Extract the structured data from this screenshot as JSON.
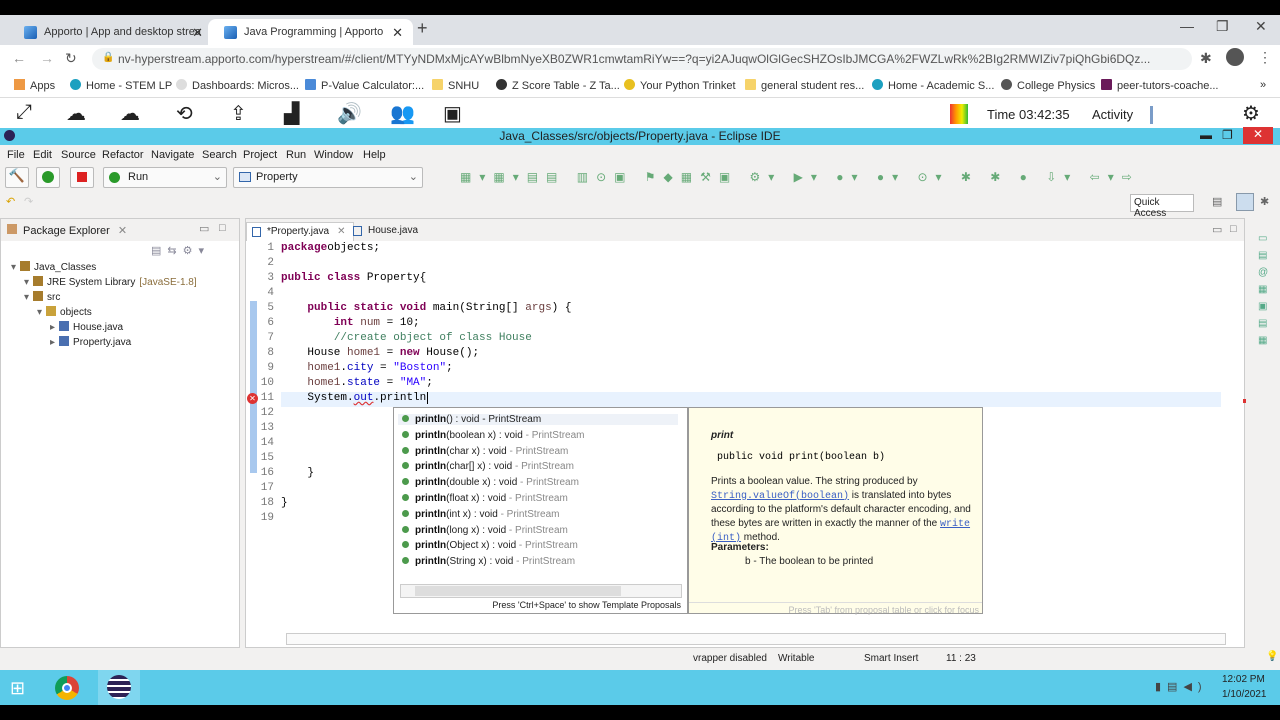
{
  "browser": {
    "tabs": [
      {
        "label": "Apporto | App and desktop strea"
      },
      {
        "label": "Java Programming | Apporto"
      }
    ],
    "url": "nv-hyperstream.apporto.com/hyperstream/#/client/MTYyNDMxMjcAYwBlbmNyeXB0ZWR1cmwtamRiYw==?q=yi2AJuqwOlGlGecSHZOsIbJMCGA%2FWZLwRk%2BIg2RMWIZiv7piQhGbi6DQz...",
    "bookmarks": [
      "Apps",
      "Home - STEM LP",
      "Dashboards: Micros...",
      "P-Value Calculator:...",
      "SNHU",
      "Z Score Table - Z Ta...",
      "Your Python Trinket",
      "general student res...",
      "Home - Academic S...",
      "College Physics",
      "peer-tutors-coache..."
    ]
  },
  "apporto": {
    "time": "Time 03:42:35",
    "activity": "Activity"
  },
  "eclipse": {
    "title": "Java_Classes/src/objects/Property.java - Eclipse IDE",
    "menu": [
      "File",
      "Edit",
      "Source",
      "Refactor",
      "Navigate",
      "Search",
      "Project",
      "Run",
      "Window",
      "Help"
    ],
    "run_combo": "Run",
    "launch_combo": "Property",
    "quick_access": "Quick Access",
    "package_explorer": {
      "title": "Package Explorer",
      "tree": [
        {
          "label": "Java_Classes",
          "level": 0
        },
        {
          "label": "JRE System Library",
          "suffix": "[JavaSE-1.8]",
          "level": 1
        },
        {
          "label": "src",
          "level": 1
        },
        {
          "label": "objects",
          "level": 2
        },
        {
          "label": "House.java",
          "level": 3
        },
        {
          "label": "Property.java",
          "level": 3
        }
      ]
    },
    "editor_tabs": [
      "*Property.java",
      "House.java"
    ],
    "code": [
      [
        [
          "kw",
          "package"
        ],
        [
          "",
          "objects;"
        ]
      ],
      [],
      [
        [
          "kw",
          "public class"
        ],
        [
          "",
          " Property{"
        ]
      ],
      [],
      [
        [
          "",
          "    "
        ],
        [
          "kw",
          "public static void"
        ],
        [
          "",
          " main(String[] "
        ],
        [
          "lv",
          "args"
        ],
        [
          "",
          ") {"
        ]
      ],
      [
        [
          "",
          "        "
        ],
        [
          "kw",
          "int"
        ],
        [
          "",
          " "
        ],
        [
          "lv",
          "num"
        ],
        [
          "",
          " = 10;"
        ]
      ],
      [
        [
          "",
          "        "
        ],
        [
          "cm",
          "//create object of class House"
        ]
      ],
      [
        [
          "",
          "    House "
        ],
        [
          "lv",
          "home1"
        ],
        [
          "",
          " = "
        ],
        [
          "kw",
          "new"
        ],
        [
          "",
          " House();"
        ]
      ],
      [
        [
          "",
          "    "
        ],
        [
          "lv",
          "home1"
        ],
        [
          "",
          "."
        ],
        [
          "fd",
          "city"
        ],
        [
          "",
          " = "
        ],
        [
          "st",
          "\"Boston\""
        ],
        [
          "",
          ";"
        ]
      ],
      [
        [
          "",
          "    "
        ],
        [
          "lv",
          "home1"
        ],
        [
          "",
          "."
        ],
        [
          "fd",
          "state"
        ],
        [
          "",
          " = "
        ],
        [
          "st",
          "\"MA\""
        ],
        [
          "",
          ";"
        ]
      ],
      [
        [
          "",
          "    System."
        ],
        [
          "fd",
          "out"
        ],
        [
          "",
          ".println"
        ]
      ],
      [],
      [],
      [],
      [],
      [
        [
          "",
          "    }"
        ]
      ],
      [],
      [
        [
          "",
          "}"
        ]
      ],
      []
    ],
    "proposals": [
      {
        "name": "println",
        "args": "()",
        "ret": " : void",
        "owner": " - PrintStream"
      },
      {
        "name": "println",
        "args": "(boolean x)",
        "ret": " : void",
        "owner": " - PrintStream"
      },
      {
        "name": "println",
        "args": "(char x)",
        "ret": " : void",
        "owner": " - PrintStream"
      },
      {
        "name": "println",
        "args": "(char[] x)",
        "ret": " : void",
        "owner": " - PrintStream"
      },
      {
        "name": "println",
        "args": "(double x)",
        "ret": " : void",
        "owner": " - PrintStream"
      },
      {
        "name": "println",
        "args": "(float x)",
        "ret": " : void",
        "owner": " - PrintStream"
      },
      {
        "name": "println",
        "args": "(int x)",
        "ret": " : void",
        "owner": " - PrintStream"
      },
      {
        "name": "println",
        "args": "(long x)",
        "ret": " : void",
        "owner": " - PrintStream"
      },
      {
        "name": "println",
        "args": "(Object x)",
        "ret": " : void",
        "owner": " - PrintStream"
      },
      {
        "name": "println",
        "args": "(String x)",
        "ret": " : void",
        "owner": " - PrintStream"
      }
    ],
    "proposal_hint": "Press 'Ctrl+Space' to show Template Proposals",
    "doc": {
      "title": "print",
      "signature": "public void print(boolean b)",
      "p1": "Prints a boolean value. The string produced by",
      "link1": "String.valueOf(boolean)",
      "p2": " is translated into bytes according to the platform's default character encoding, and these bytes are written in exactly the manner of the ",
      "link2": "write (int)",
      "p3": " method.",
      "params_label": "Parameters:",
      "param": "b - The boolean to be printed",
      "footer": "Press 'Tab' from proposal table or click for focus"
    },
    "status": {
      "vrapper": "vrapper disabled",
      "writable": "Writable",
      "insert": "Smart Insert",
      "position": "11 : 23"
    }
  },
  "taskbar": {
    "time": "12:02 PM",
    "date": "1/10/2021"
  }
}
